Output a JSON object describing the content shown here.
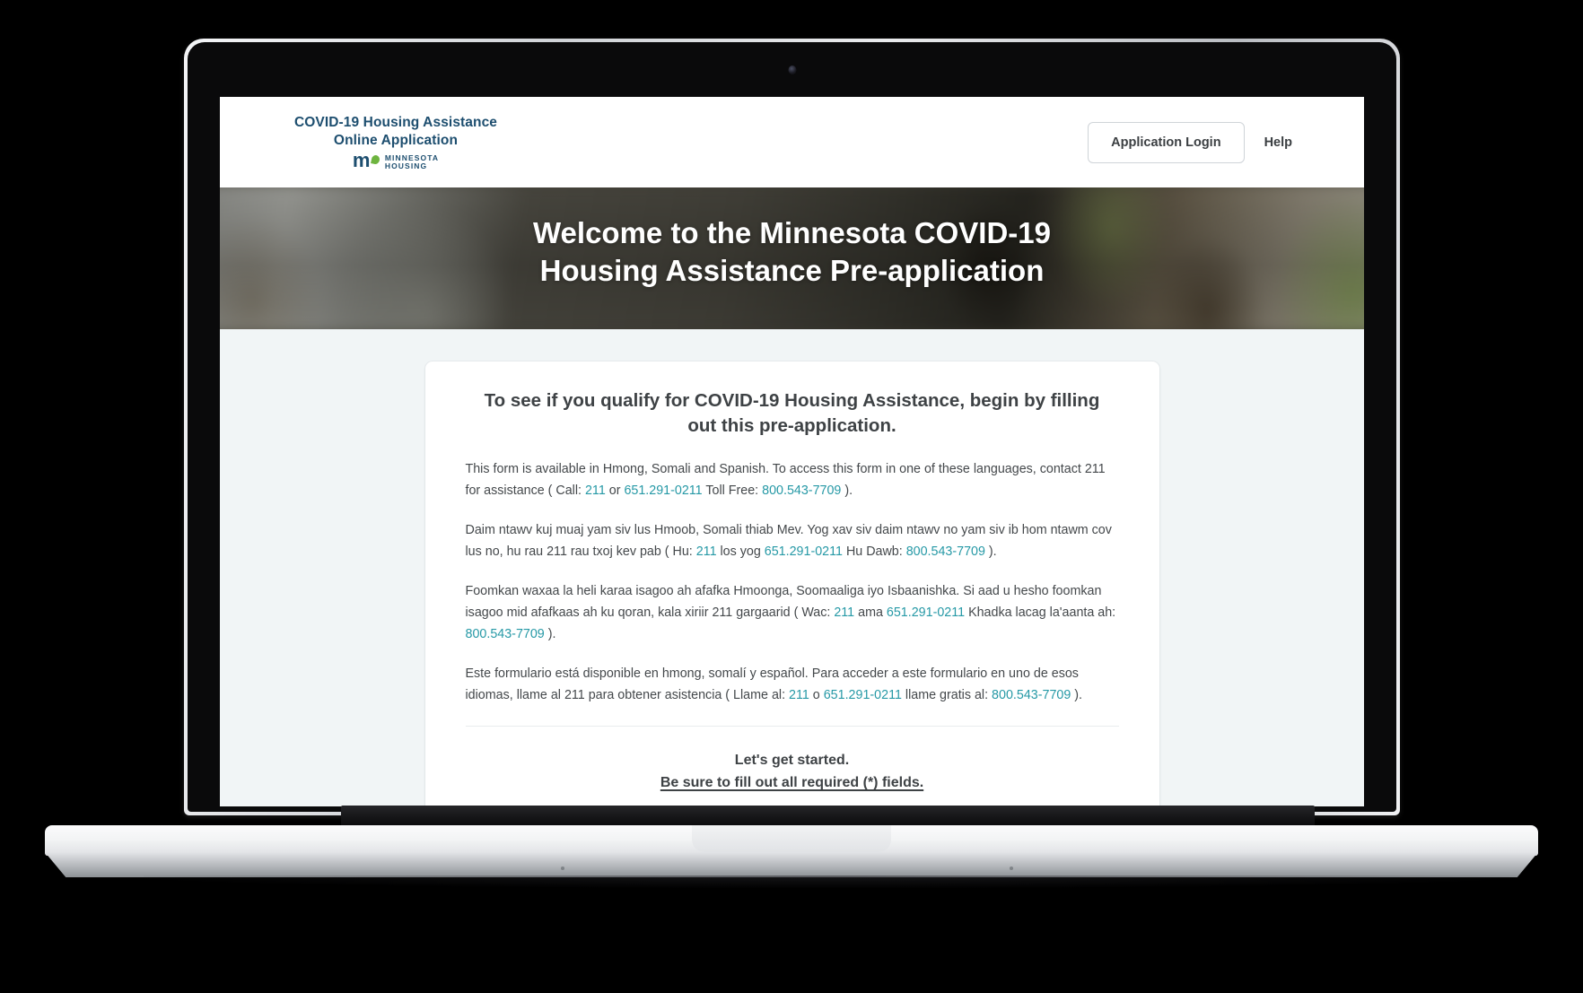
{
  "device": {
    "kind": "laptop-mockup",
    "webcam_icon": "webcam-dot-icon"
  },
  "header": {
    "brand": {
      "line1": "COVID-19 Housing Assistance",
      "line2": "Online Application",
      "agency_mark": "mn-logo-icon",
      "agency_name_line1": "MINNESOTA",
      "agency_name_line2": "HOUSING",
      "title_color": "#1d4e6f",
      "leaf_color": "#6eb43f"
    },
    "login_label": "Application Login",
    "help_label": "Help"
  },
  "hero": {
    "title_line1": "Welcome to the Minnesota COVID-19",
    "title_line2": "Housing Assistance Pre-application",
    "image_description": "blurred living room with sofa and plants"
  },
  "card": {
    "heading_line1": "To see if you qualify for COVID-19 Housing Assistance, begin by filling",
    "heading_line2": "out this pre-application.",
    "link_color": "#2699a6",
    "paragraphs": [
      {
        "language": "English",
        "segments": [
          {
            "text": "This form is available in Hmong, Somali and Spanish. To access this form in one of these languages, contact 211 for assistance ( Call: ",
            "link": false
          },
          {
            "text": "211",
            "link": true
          },
          {
            "text": " or ",
            "link": false
          },
          {
            "text": "651.291-0211",
            "link": true
          },
          {
            "text": " Toll Free: ",
            "link": false
          },
          {
            "text": "800.543-7709",
            "link": true
          },
          {
            "text": " ).",
            "link": false
          }
        ]
      },
      {
        "language": "Hmong",
        "segments": [
          {
            "text": "Daim ntawv kuj muaj yam siv lus Hmoob, Somali thiab Mev. Yog xav siv daim ntawv no yam siv ib hom ntawm cov lus no, hu rau 211 rau txoj kev pab ( Hu: ",
            "link": false
          },
          {
            "text": "211",
            "link": true
          },
          {
            "text": " los yog ",
            "link": false
          },
          {
            "text": "651.291-0211",
            "link": true
          },
          {
            "text": " Hu Dawb: ",
            "link": false
          },
          {
            "text": "800.543-7709",
            "link": true
          },
          {
            "text": " ).",
            "link": false
          }
        ]
      },
      {
        "language": "Somali",
        "segments": [
          {
            "text": "Foomkan waxaa la heli karaa isagoo ah afafka Hmoonga, Soomaaliga iyo Isbaanishka. Si aad u hesho foomkan isagoo mid afafkaas ah ku qoran, kala xiriir 211 gargaarid ( Wac: ",
            "link": false
          },
          {
            "text": "211",
            "link": true
          },
          {
            "text": " ama ",
            "link": false
          },
          {
            "text": "651.291-0211",
            "link": true
          },
          {
            "text": " Khadka lacag la'aanta ah: ",
            "link": false
          },
          {
            "text": "800.543-7709",
            "link": true
          },
          {
            "text": " ).",
            "link": false
          }
        ]
      },
      {
        "language": "Spanish",
        "segments": [
          {
            "text": "Este formulario está disponible en hmong, somalí y español. Para acceder a este formulario en uno de esos idiomas, llame al 211 para obtener asistencia ( Llame al: ",
            "link": false
          },
          {
            "text": "211",
            "link": true
          },
          {
            "text": " o ",
            "link": false
          },
          {
            "text": "651.291-0211",
            "link": true
          },
          {
            "text": " llame gratis al: ",
            "link": false
          },
          {
            "text": "800.543-7709",
            "link": true
          },
          {
            "text": " ).",
            "link": false
          }
        ]
      }
    ],
    "start_line1": "Let's get started.",
    "start_line2": "Be sure to fill out all required (*) fields."
  },
  "colors": {
    "page_background": "#f1f5f6",
    "card_background": "#ffffff",
    "text_primary": "#3e4245",
    "brand_navy": "#1d4e6f",
    "link_teal": "#2699a6"
  }
}
